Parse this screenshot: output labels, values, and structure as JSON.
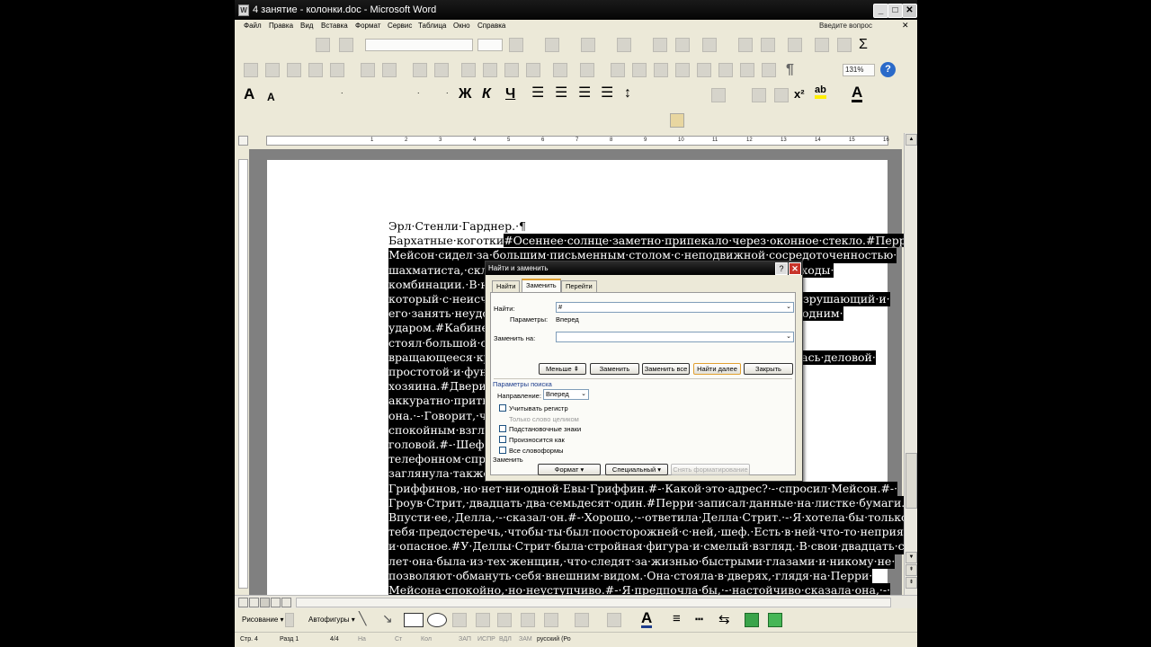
{
  "window": {
    "title": "4 занятие - колонки.doc - Microsoft Word",
    "app_icon": "word-icon"
  },
  "menu": {
    "items": [
      "Файл",
      "Правка",
      "Вид",
      "Вставка",
      "Формат",
      "Сервис",
      "Таблица",
      "Окно",
      "Справка"
    ],
    "ask_question_placeholder": "Введите вопрос"
  },
  "toolbar": {
    "zoom": "131%",
    "font_style_size_sample": "."
  },
  "formatting_buttons": {
    "bold": "Ж",
    "italic": "К",
    "underline": "Ч",
    "superscript": "x²",
    "font_color": "A",
    "grow_font": "A",
    "shrink_font": "A",
    "highlight": "ab"
  },
  "ruler": {
    "ticks": [
      "1",
      "2",
      "3",
      "4",
      "5",
      "6",
      "7",
      "8",
      "9",
      "10",
      "11",
      "12",
      "13",
      "14",
      "15",
      "16",
      "17"
    ]
  },
  "document": {
    "lines": [
      {
        "text": "Эрл·Стенли·Гарднер.·¶"
      },
      {
        "pre": "Бархатные·коготки",
        "sel": "#Осеннее·солнце·заметно·припекало·через·оконное·стекло.#Перри·"
      },
      {
        "full": "Мейсон·сидел·за·большим·письменным·столом·с·неподвижной·сосредоточенностью·"
      },
      {
        "full": "шахматиста,·склонившегося·над·доской·и·обдумывающего·сложные·ходы·"
      },
      {
        "full": "комбинации.·В·нем·было·что-то·от·боксера·на·ринге,·"
      },
      {
        "full": "который·с·неисчерпаемым·терпением·ждет·возможности·нанести·разрушающий·и·"
      },
      {
        "full": "его·занять·неудобную·позицию,·чтобы·затем·сокрушить·противника·одним·"
      },
      {
        "full": "ударом.#Кабинет·был·просторным·и·уютным.·В·углу·у·окна·"
      },
      {
        "full": "стоял·большой·сейф.·Кроме·того,·в·кабинете·было·удобное·"
      },
      {
        "full": "вращающееся·кресло,·в·котором·сидел·адвокат.·Обстановка·отличалась·деловой·"
      },
      {
        "full": "простотой·и·функциональностью,·как·и·сам·его·"
      },
      {
        "full": "хозяина.#Двери·открылись,·и·в·кабинет·вошла·Делла·Стрит.·Она·"
      },
      {
        "full": "аккуратно·притворила·за·собой·дверь·и·сказала·"
      },
      {
        "full": "она.·-·Говорит,·что·ее·зовут·Ева·Гриффин.·Перри·посмотрел·на·нее·"
      },
      {
        "full": "спокойным·взглядом.#-·Какая·она?"
      },
      {
        "full": "головой.#-·Шеф,·в·ней·что-то·не·так.·Я·искала·Гриффинов·в·"
      },
      {
        "full": "телефонном·справочнике.·"
      },
      {
        "full": "заглянула·также·в·адресную·книгу.·Там·есть·несколько·"
      },
      {
        "full": "Гриффинов,·но·нет·ни·одной·Евы·Гриффин.#-·Какой·это·адрес?·-·спросил·Мейсон.#-·"
      },
      {
        "full": "Гроув·Стрит,·двадцать·два·семьдесят·один.#Перри·записал·данные·на·листке·бумаги.#-·"
      },
      {
        "full": "Впусти·ее,·Делла,·-·сказал·он.#-·Хорошо,·-·ответила·Делла·Стрит.·-·Я·хотела·бы·только·"
      },
      {
        "full": "тебя·предостеречь,·чтобы·ты·был·поосторожней·с·ней,·шеф.·Есть·в·ней·что-то·неприятное·"
      },
      {
        "full": "и·опасное.#У·Деллы·Стрит·была·стройная·фигура·и·смелый·взгляд.·В·свои·двадцать·семь·"
      },
      {
        "full": "лет·она·была·из·тех·женщин,·что·следят·за·жизнью·быстрыми·глазами·и·никому·не·"
      },
      {
        "full": "позволяют·обмануть·себя·внешним·видом.·Она·стояла·в·дверях,·глядя·на·Перри·"
      },
      {
        "full": "Мейсона·спокойно,·но·неуступчиво.#-·Я·предпочла·бы,·-·настойчиво·сказала·она,·-·"
      }
    ]
  },
  "dialog": {
    "title": "Найти и заменить",
    "tabs": [
      "Найти",
      "Заменить",
      "Перейти"
    ],
    "find_label": "Найти:",
    "find_value": "#",
    "params_label": "Параметры:",
    "params_value": "Вперед",
    "replace_label": "Заменить на:",
    "replace_value": "",
    "buttons": {
      "less": "Меньше ⇞",
      "replace": "Заменить",
      "replace_all": "Заменить все",
      "find_next": "Найти далее",
      "close": "Закрыть",
      "format": "Формат ▾",
      "special": "Специальный ▾",
      "no_formatting": "Снять форматирование"
    },
    "search_params_title": "Параметры поиска",
    "direction_label": "Направление:",
    "direction_value": "Вперед",
    "options": {
      "match_case": "Учитывать регистр",
      "whole_words": "Только слово целиком",
      "wildcards": "Подстановочные знаки",
      "sounds_like": "Произносится как",
      "all_forms": "Все словоформы"
    },
    "replace_section": "Заменить"
  },
  "drawing": {
    "draw_label": "Рисование ▾",
    "autoshapes_label": "Автофигуры ▾"
  },
  "status": {
    "page": "Стр. 4",
    "section": "Разд 1",
    "pages": "4/4",
    "at": "На",
    "line": "Ст",
    "col": "Кол",
    "rec": "ЗАП",
    "trk": "ИСПР",
    "ext": "ВДЛ",
    "ovr": "ЗАМ",
    "lang": "русский (Ро"
  }
}
